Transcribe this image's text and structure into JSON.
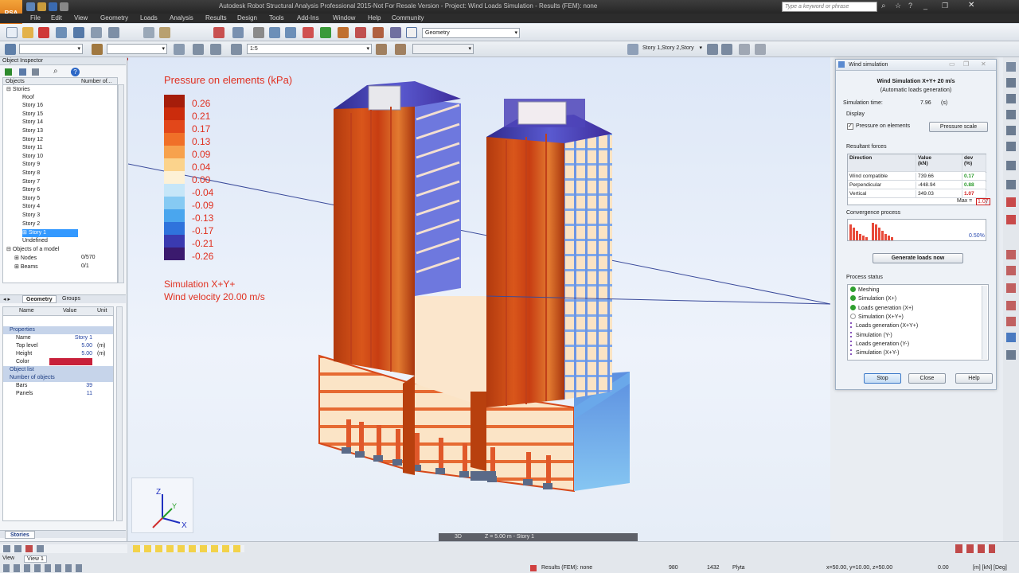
{
  "app": {
    "logo": "RSA PRO",
    "title": "Autodesk Robot Structural Analysis Professional 2015-Not For Resale Version - Project: Wind Loads Simulation - Results (FEM): none",
    "search_placeholder": "Type a keyword or phrase"
  },
  "menu": [
    "File",
    "Edit",
    "View",
    "Geometry",
    "Loads",
    "Analysis",
    "Results",
    "Design",
    "Tools",
    "Add-Ins",
    "Window",
    "Help",
    "Community"
  ],
  "toolbar": {
    "layout_select": "Geometry",
    "scale_select": "1:5",
    "story_select": "Story 1,Story 2,Story"
  },
  "object_inspector": {
    "title": "Object Inspector",
    "col_objects": "Objects",
    "col_number": "Number of...",
    "tree": [
      {
        "label": "Stories",
        "indent": 0,
        "expander": "⊟"
      },
      {
        "label": "Roof",
        "indent": 2
      },
      {
        "label": "Story 16",
        "indent": 2
      },
      {
        "label": "Story 15",
        "indent": 2
      },
      {
        "label": "Story 14",
        "indent": 2
      },
      {
        "label": "Story 13",
        "indent": 2
      },
      {
        "label": "Story 12",
        "indent": 2
      },
      {
        "label": "Story 11",
        "indent": 2
      },
      {
        "label": "Story 10",
        "indent": 2
      },
      {
        "label": "Story 9",
        "indent": 2
      },
      {
        "label": "Story 8",
        "indent": 2
      },
      {
        "label": "Story 7",
        "indent": 2
      },
      {
        "label": "Story 6",
        "indent": 2
      },
      {
        "label": "Story 5",
        "indent": 2
      },
      {
        "label": "Story 4",
        "indent": 2
      },
      {
        "label": "Story 3",
        "indent": 2
      },
      {
        "label": "Story 2",
        "indent": 2
      },
      {
        "label": "Story 1",
        "indent": 2,
        "selected": true,
        "expander": "⊞"
      },
      {
        "label": "Undefined",
        "indent": 2
      },
      {
        "label": "Objects of a model",
        "indent": 0,
        "expander": "⊟"
      },
      {
        "label": "Nodes",
        "indent": 1,
        "count": "0/570",
        "expander": "⊞"
      },
      {
        "label": "Beams",
        "indent": 1,
        "count": "0/1",
        "expander": "⊞"
      }
    ],
    "tabs": [
      "Geometry",
      "Groups"
    ],
    "props_cols": [
      "Name",
      "Value",
      "Unit"
    ],
    "props": [
      {
        "type": "section",
        "label": "Properties"
      },
      {
        "name": "Name",
        "value": "Story 1",
        "unit": ""
      },
      {
        "name": "Top level",
        "value": "5.00",
        "unit": "(m)"
      },
      {
        "name": "Height",
        "value": "5.00",
        "unit": "(m)"
      },
      {
        "name": "Color",
        "value": "",
        "unit": "",
        "color": "#c8203a"
      },
      {
        "type": "section",
        "label": "Object list"
      },
      {
        "type": "section",
        "label": "Number of objects"
      },
      {
        "name": "Bars",
        "value": "39",
        "unit": ""
      },
      {
        "name": "Panels",
        "value": "11",
        "unit": ""
      }
    ],
    "bottom_tab": "Stories"
  },
  "viewport": {
    "legend_title": "Pressure on elements (kPa)",
    "legend": [
      {
        "value": "0.26",
        "color": "#a51d0a"
      },
      {
        "value": "0.21",
        "color": "#cb2c0c"
      },
      {
        "value": "0.17",
        "color": "#e2471a"
      },
      {
        "value": "0.13",
        "color": "#f07028"
      },
      {
        "value": "0.09",
        "color": "#f7a24d"
      },
      {
        "value": "0.04",
        "color": "#fbd38c"
      },
      {
        "value": "0.00",
        "color": "#fdf1d6"
      },
      {
        "value": "-0.04",
        "color": "#c6e6f8"
      },
      {
        "value": "-0.09",
        "color": "#86caf3"
      },
      {
        "value": "-0.13",
        "color": "#4aa6ee"
      },
      {
        "value": "-0.17",
        "color": "#2f73dc"
      },
      {
        "value": "-0.21",
        "color": "#3a3ab0"
      },
      {
        "value": "-0.26",
        "color": "#3b1a6e"
      }
    ],
    "sim_line1": "Simulation X+Y+",
    "sim_line2": "Wind velocity 20.00 m/s",
    "view_mode": "3D",
    "view_level": "Z = 5.00 m - Story 1"
  },
  "wind_dialog": {
    "title": "Wind simulation",
    "heading": "Wind Simulation X+Y+ 20 m/s",
    "subheading": "(Automatic loads generation)",
    "sim_time_label": "Simulation time:",
    "sim_time_value": "7.96",
    "sim_time_unit": "(s)",
    "display_label": "Display",
    "pressure_checkbox": "Pressure on elements",
    "pressure_scale_btn": "Pressure scale",
    "resultant_label": "Resultant forces",
    "forces_cols": [
      "Direction",
      "Value\n(kN)",
      "dev\n(%)"
    ],
    "forces": [
      {
        "dir": "Wind compatible",
        "value": "739.66",
        "dev": "0.17",
        "dev_color": "#2a9a2a"
      },
      {
        "dir": "Perpendicular",
        "value": "-448.94",
        "dev": "0.88",
        "dev_color": "#2a9a2a"
      },
      {
        "dir": "Vertical",
        "value": "349.03",
        "dev": "1.07",
        "dev_color": "#d02020"
      }
    ],
    "max_label": "Max =",
    "max_value": "1.07",
    "convergence_label": "Convergence process",
    "convergence_value": "0.50%",
    "generate_btn": "Generate loads now",
    "process_label": "Process status",
    "process": [
      {
        "label": "Meshing",
        "state": "done"
      },
      {
        "label": "Simulation (X+)",
        "state": "done"
      },
      {
        "label": "Loads generation (X+)",
        "state": "done"
      },
      {
        "label": "Simulation (X+Y+)",
        "state": "run"
      },
      {
        "label": "Loads generation (X+Y+)",
        "state": "wait"
      },
      {
        "label": "Simulation (Y-)",
        "state": "wait"
      },
      {
        "label": "Loads generation (Y-)",
        "state": "wait"
      },
      {
        "label": "Simulation (X+Y-)",
        "state": "wait"
      }
    ],
    "stop_btn": "Stop",
    "close_btn": "Close",
    "help_btn": "Help"
  },
  "status": {
    "tab_view": "View",
    "tab_view1": "View 1",
    "results": "Results (FEM): none",
    "num1": "980",
    "num2": "1432",
    "material": "Plyta",
    "coords": "x=50.00, y=10.00, z=50.00",
    "angle": "0.00",
    "units": "[m] [kN] [Deg]"
  }
}
